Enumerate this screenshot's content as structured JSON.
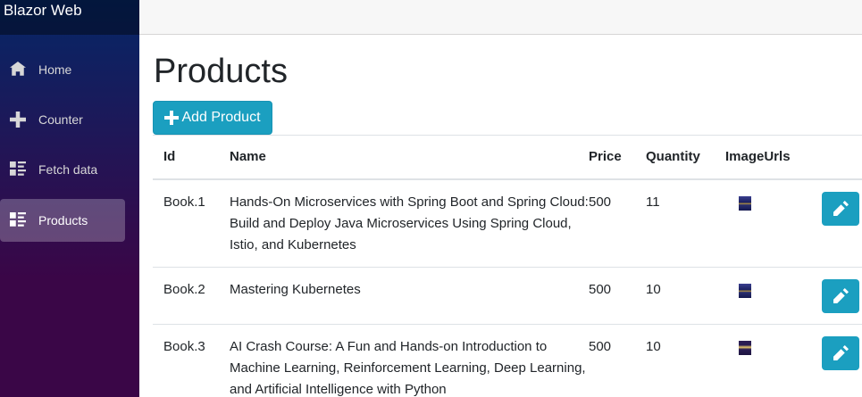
{
  "brand": "Blazor Web",
  "nav": [
    {
      "label": "Home",
      "icon": "home-icon"
    },
    {
      "label": "Counter",
      "icon": "plus-icon"
    },
    {
      "label": "Fetch data",
      "icon": "list-rich-icon"
    },
    {
      "label": "Products",
      "icon": "list-rich-icon",
      "active": true
    }
  ],
  "page": {
    "title": "Products",
    "add_button": "Add Product"
  },
  "table": {
    "headers": [
      "Id",
      "Name",
      "Price",
      "Quantity",
      "ImageUrls"
    ],
    "rows": [
      {
        "id": "Book.1",
        "name": "Hands-On Microservices with Spring Boot and Spring Cloud: Build and Deploy Java Microservices Using Spring Cloud, Istio, and Kubernetes",
        "price": "500",
        "quantity": "11",
        "image": "book-cover-thumbnail"
      },
      {
        "id": "Book.2",
        "name": "Mastering Kubernetes",
        "price": "500",
        "quantity": "10",
        "image": "book-cover-thumbnail"
      },
      {
        "id": "Book.3",
        "name": "AI Crash Course: A Fun and Hands-on Introduction to Machine Learning, Reinforcement Learning, Deep Learning, and Artificial Intelligence with Python",
        "price": "500",
        "quantity": "10",
        "image": "book-cover-thumbnail"
      }
    ]
  },
  "colors": {
    "accent": "#1b9fc0",
    "sidebar_top": "#052767",
    "sidebar_bottom": "#3a0647"
  }
}
